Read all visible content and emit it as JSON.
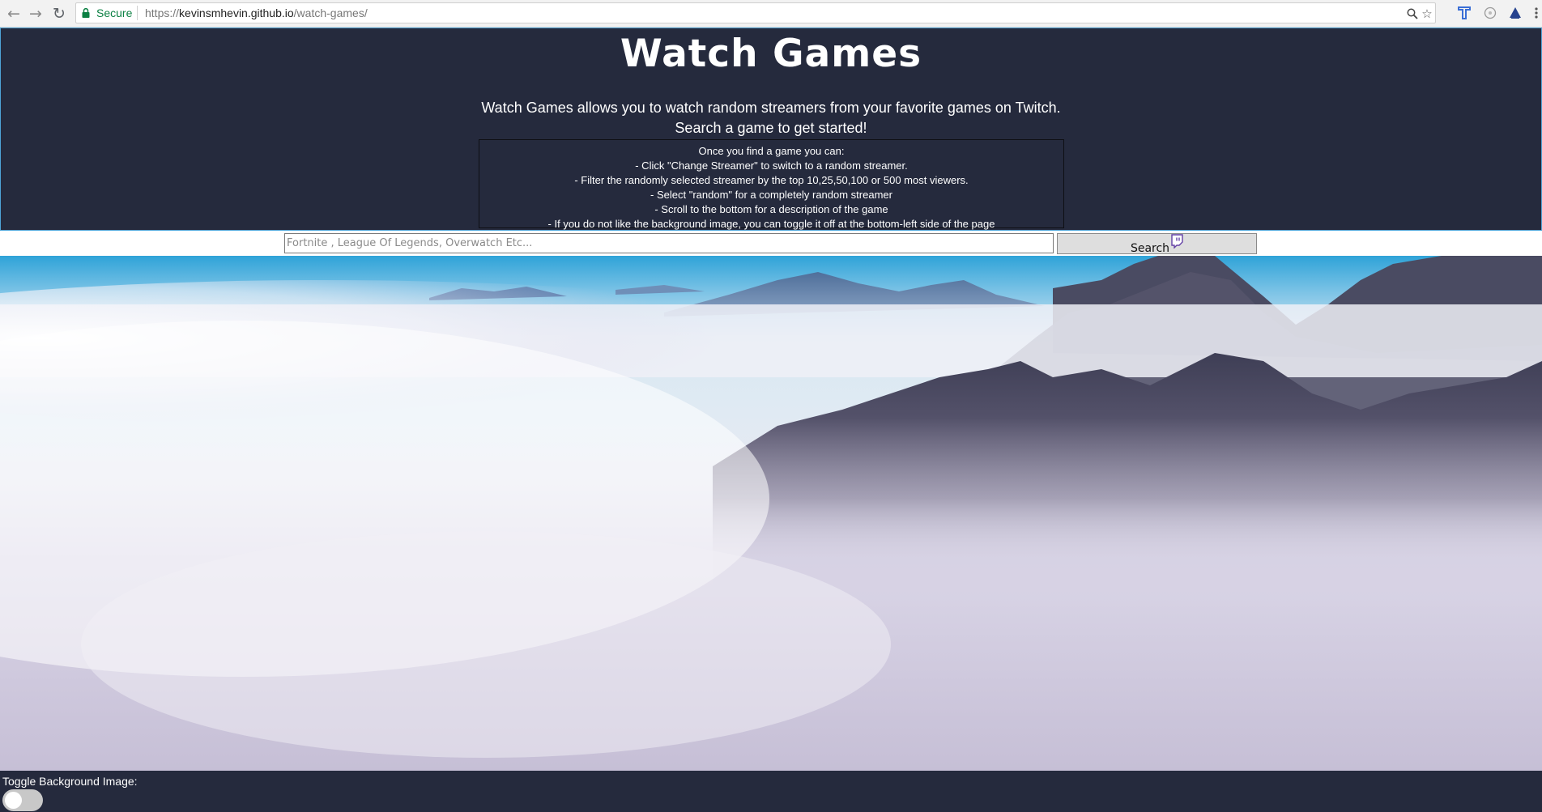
{
  "browser": {
    "secure_label": "Secure",
    "url_scheme": "https://",
    "url_host": "kevinsmhevin.github.io",
    "url_path": "/watch-games/",
    "icons": [
      "back-icon",
      "forward-icon",
      "reload-icon",
      "lock-icon",
      "zoom-icon",
      "star-icon",
      "extension-icon",
      "extension-icon",
      "extension-icon",
      "menu-icon"
    ]
  },
  "header": {
    "title": "Watch Games",
    "intro_line1": "Watch Games allows you to watch random streamers from your favorite games on Twitch.",
    "intro_line2": "Search a game to get started!",
    "info_lines": [
      "Once you find a game you can:",
      "- Click \"Change Streamer\" to switch to a random streamer.",
      "- Filter the randomly selected streamer by the top 10,25,50,100 or 500 most viewers.",
      "- Select \"random\" for a completely random streamer",
      "- Scroll to the bottom for a description of the game",
      "- If you do not like the background image, you can toggle it off at the bottom-left side of the page"
    ]
  },
  "search": {
    "placeholder": "Fortnite , League Of Legends, Overwatch Etc...",
    "value": "",
    "button_label": "Search"
  },
  "footer": {
    "toggle_label": "Toggle Background Image:",
    "toggle_on": false
  },
  "colors": {
    "header_bg": "#252a3d",
    "header_border": "#4ea3d6",
    "secure_green": "#0b8043",
    "twitch_purple": "#6441a5"
  }
}
